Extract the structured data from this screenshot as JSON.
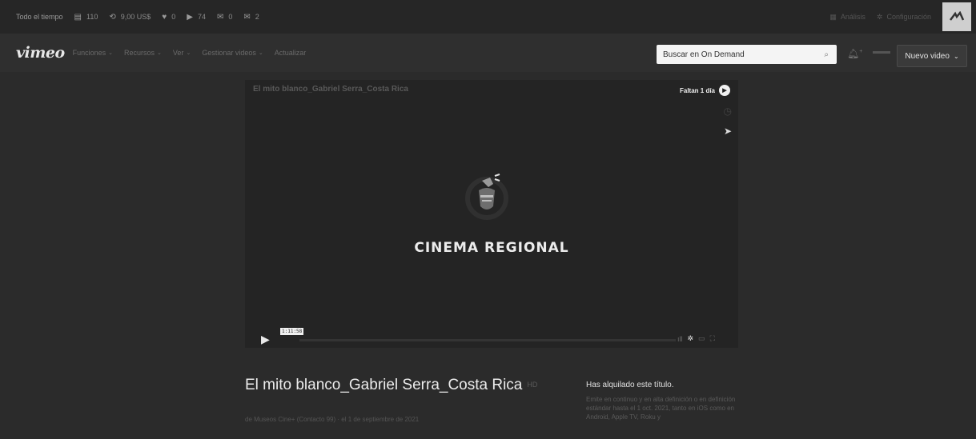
{
  "topbar": {
    "period": "Todo el tiempo",
    "stats": [
      {
        "icon": "document-icon",
        "glyph": "▤",
        "value": "110"
      },
      {
        "icon": "refresh-icon",
        "glyph": "⟲",
        "value": "9,00 US$"
      },
      {
        "icon": "heart-icon",
        "glyph": "♥",
        "value": "0"
      },
      {
        "icon": "play-icon",
        "glyph": "▶",
        "value": "74"
      },
      {
        "icon": "comment-icon",
        "glyph": "✉",
        "value": "0"
      },
      {
        "icon": "mail-icon",
        "glyph": "✉",
        "value": "2"
      }
    ],
    "analytics": "Análisis",
    "settings": "Configuración"
  },
  "nav": {
    "logo": "vimeo",
    "items": [
      "Funciones",
      "Recursos",
      "Ver",
      "Gestionar videos",
      "Actualizar"
    ],
    "search_placeholder": "Buscar en On Demand",
    "new_video": "Nuevo video"
  },
  "player": {
    "title": "El mito blanco_Gabriel Serra_Costa Rica",
    "countdown": "Faltan 1 día",
    "center_text": "CINEMA REGIONAL",
    "timecode": "1:11:58"
  },
  "video": {
    "title": "El mito blanco_Gabriel Serra_Costa Rica",
    "badge": "HD",
    "byline": "de Museos Cine+ (Contacto 99) · el 1 de septiembre de 2021"
  },
  "rental": {
    "heading": "Has alquilado este título.",
    "description": "Emite en continuo y en alta definición o en definición estándar hasta el 1 oct. 2021, tanto en iOS como en Android, Apple TV, Roku y"
  },
  "colors": {
    "background": "#2b2b2b",
    "topbar": "#262626",
    "player": "#242424",
    "text_light": "#ececec"
  }
}
